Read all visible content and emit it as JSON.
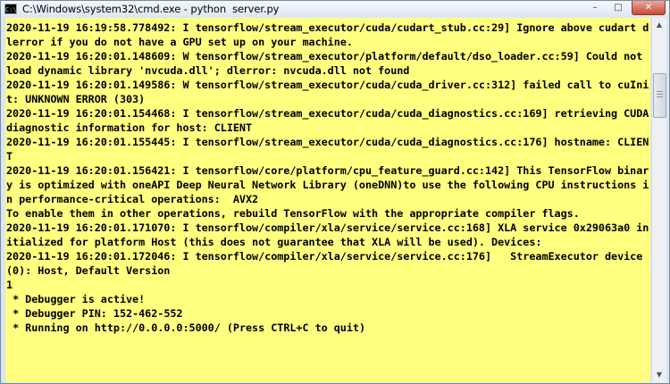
{
  "window": {
    "title": "C:\\Windows\\system32\\cmd.exe - python  server.py",
    "app_icon_label": "C:\\",
    "controls": {
      "minimize": "–",
      "maximize": "□",
      "close": "✕"
    }
  },
  "console": {
    "lines": [
      "2020-11-19 16:19:58.778492: I tensorflow/stream_executor/cuda/cudart_stub.cc:29] Ignore above cudart dlerror if you do not have a GPU set up on your machine.",
      "2020-11-19 16:20:01.148609: W tensorflow/stream_executor/platform/default/dso_loader.cc:59] Could not load dynamic library 'nvcuda.dll'; dlerror: nvcuda.dll not found",
      "2020-11-19 16:20:01.149586: W tensorflow/stream_executor/cuda/cuda_driver.cc:312] failed call to cuInit: UNKNOWN ERROR (303)",
      "2020-11-19 16:20:01.154468: I tensorflow/stream_executor/cuda/cuda_diagnostics.cc:169] retrieving CUDA diagnostic information for host: CLIENT",
      "2020-11-19 16:20:01.155445: I tensorflow/stream_executor/cuda/cuda_diagnostics.cc:176] hostname: CLIENT",
      "2020-11-19 16:20:01.156421: I tensorflow/core/platform/cpu_feature_guard.cc:142] This TensorFlow binary is optimized with oneAPI Deep Neural Network Library (oneDNN)to use the following CPU instructions in performance-critical operations:  AVX2",
      "To enable them in other operations, rebuild TensorFlow with the appropriate compiler flags.",
      "2020-11-19 16:20:01.171070: I tensorflow/compiler/xla/service/service.cc:168] XLA service 0x29063a0 initialized for platform Host (this does not guarantee that XLA will be used). Devices:",
      "2020-11-19 16:20:01.172046: I tensorflow/compiler/xla/service/service.cc:176]   StreamExecutor device (0): Host, Default Version",
      "1",
      " * Debugger is active!",
      " * Debugger PIN: 152-462-552",
      " * Running on http://0.0.0.0:5000/ (Press CTRL+C to quit)"
    ]
  },
  "colors": {
    "console_background": "#ffff80",
    "console_text": "#000000"
  },
  "scrollbar": {
    "up_arrow": "▲",
    "down_arrow": "▼"
  }
}
